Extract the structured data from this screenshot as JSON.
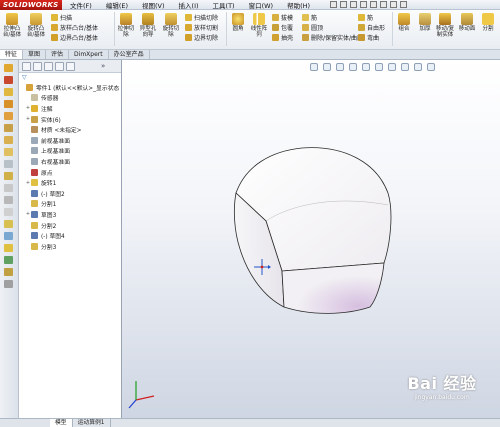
{
  "app": {
    "logo_text": "SOLIDWORKS"
  },
  "menu": [
    {
      "id": "file",
      "label": "文件(F)"
    },
    {
      "id": "edit",
      "label": "编辑(E)"
    },
    {
      "id": "view",
      "label": "视图(V)"
    },
    {
      "id": "insert",
      "label": "插入(I)"
    },
    {
      "id": "tools",
      "label": "工具(T)"
    },
    {
      "id": "window",
      "label": "窗口(W)"
    },
    {
      "id": "help",
      "label": "帮助(H)"
    }
  ],
  "ribbon": {
    "extrude_boss": "拉伸凸\n台/基体",
    "revolve_boss": "旋转凸\n台/基体",
    "sweep": "扫描",
    "loft": "放样凸台/基体",
    "boundary": "边界凸台/基体",
    "extrude_cut": "拉伸切\n除",
    "hole_wizard": "异型孔\n向导",
    "revolve_cut": "旋转切\n除",
    "sweep_cut": "扫描切除",
    "loft_cut": "放样切割",
    "boundary_cut": "边界切除",
    "fillet": "圆角",
    "linear_pattern": "线性阵\n列",
    "rib": "筋",
    "draft": "拔模",
    "shell": "抽壳",
    "wrap": "包覆",
    "intersect": "圆顶",
    "mirror": "镜向",
    "delete_keep": "删除/保留实体/曲面",
    "rib2": "筋",
    "freeform": "自由形",
    "dome": "弯曲",
    "combine": "组合",
    "thicken": "加厚",
    "move_copy": "移动/复\n制实体",
    "move_face": "移动面",
    "split": "分割"
  },
  "command_tabs": [
    {
      "label": "特征",
      "active": true
    },
    {
      "label": "草图",
      "active": false
    },
    {
      "label": "评估",
      "active": false
    },
    {
      "label": "DimXpert",
      "active": false
    },
    {
      "label": "办公室产品",
      "active": false
    }
  ],
  "feature_tree": {
    "items": [
      {
        "label": "零件1 (默认<<默认>_显示状态",
        "level": 0,
        "expander": "",
        "icon_color": "#d8a23a"
      },
      {
        "label": "传感器",
        "level": 1,
        "expander": "",
        "icon_color": "#c8c0a0"
      },
      {
        "label": "注解",
        "level": 1,
        "expander": "+",
        "icon_color": "#e0b030"
      },
      {
        "label": "实体(6)",
        "level": 1,
        "expander": "+",
        "icon_color": "#c8a048"
      },
      {
        "label": "材质 <未指定>",
        "level": 1,
        "expander": "",
        "icon_color": "#b8905c"
      },
      {
        "label": "前视基准面",
        "level": 1,
        "expander": "",
        "icon_color": "#9aa8b8"
      },
      {
        "label": "上视基准面",
        "level": 1,
        "expander": "",
        "icon_color": "#9aa8b8"
      },
      {
        "label": "右视基准面",
        "level": 1,
        "expander": "",
        "icon_color": "#9aa8b8"
      },
      {
        "label": "原点",
        "level": 1,
        "expander": "",
        "icon_color": "#c04040"
      },
      {
        "label": "旋转1",
        "level": 1,
        "expander": "+",
        "icon_color": "#e0c040"
      },
      {
        "label": "(-) 草图2",
        "level": 1,
        "expander": "",
        "icon_color": "#5a7ab0"
      },
      {
        "label": "分割1",
        "level": 1,
        "expander": "",
        "icon_color": "#d8b848"
      },
      {
        "label": "草图3",
        "level": 1,
        "expander": "+",
        "icon_color": "#5a7ab0"
      },
      {
        "label": "分割2",
        "level": 1,
        "expander": "",
        "icon_color": "#d8b848"
      },
      {
        "label": "(-) 草图4",
        "level": 1,
        "expander": "",
        "icon_color": "#5a7ab0"
      },
      {
        "label": "分割3",
        "level": 1,
        "expander": "",
        "icon_color": "#d8b848"
      }
    ]
  },
  "viewport": {
    "part_color": "#f0eef2",
    "shadow_color": "#d8c8e0"
  },
  "status_tabs": [
    {
      "label": "模型",
      "active": true
    },
    {
      "label": "运动算例1",
      "active": false
    }
  ],
  "watermark": {
    "text": "Bai 经验",
    "url": "jingyan.baidu.com"
  }
}
